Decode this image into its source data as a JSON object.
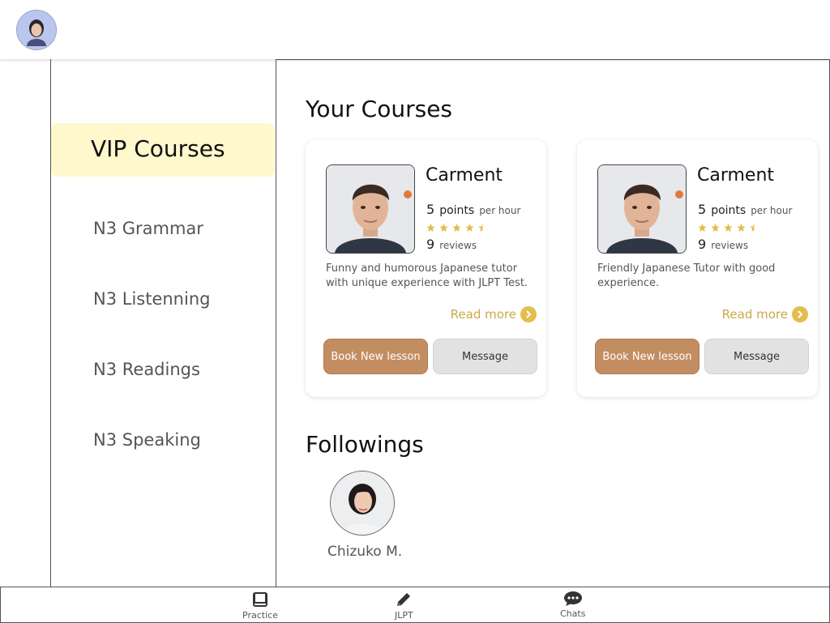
{
  "header": {
    "avatar_icon": "user-avatar"
  },
  "sidebar": {
    "active_label": "VIP Courses",
    "items": [
      {
        "label": "N3 Grammar"
      },
      {
        "label": "N3 Listenning"
      },
      {
        "label": "N3 Readings"
      },
      {
        "label": "N3 Speaking"
      }
    ]
  },
  "main": {
    "courses_title": "Your Courses",
    "courses": [
      {
        "name": "Carment",
        "points": "5",
        "points_label": "points",
        "per_hour": "per hour",
        "rating": 4.5,
        "reviews": "9",
        "reviews_label": "reviews",
        "description": "Funny and humorous Japanese tutor with unique experience with JLPT Test.",
        "read_more": "Read more",
        "book_label": "Book New lesson",
        "message_label": "Message"
      },
      {
        "name": "Carment",
        "points": "5",
        "points_label": "points",
        "per_hour": "per hour",
        "rating": 4.5,
        "reviews": "9",
        "reviews_label": "reviews",
        "description": "Friendly Japanese Tutor with good experience.",
        "read_more": "Read more",
        "book_label": "Book New lesson",
        "message_label": "Message"
      }
    ],
    "followings_title": "Followings",
    "followings": [
      {
        "name": "Chizuko M."
      }
    ]
  },
  "bottom_nav": [
    {
      "label": "Practice",
      "icon": "book-icon"
    },
    {
      "label": "JLPT",
      "icon": "pencil-icon"
    },
    {
      "label": "Chats",
      "icon": "chat-bubble-icon"
    }
  ],
  "colors": {
    "accent_gold": "#e2be4e",
    "book_button": "#c38d62",
    "vip_highlight": "#fff8cc"
  }
}
